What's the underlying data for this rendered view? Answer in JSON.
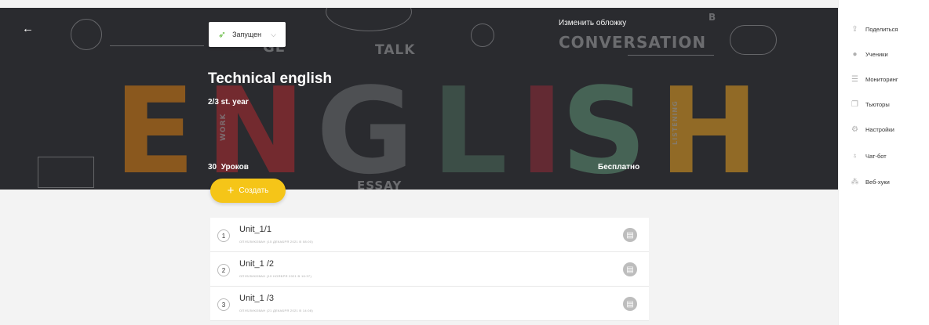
{
  "header": {
    "back_icon": "arrow-left-icon",
    "status": {
      "label": "Запущен",
      "icon": "rocket-icon"
    },
    "change_cover_label": "Изменить обложку",
    "banner_words": [
      "GE",
      "TALK",
      "CONVERSATION",
      "B",
      "ESSAY"
    ],
    "banner_letters": [
      "E",
      "N",
      "G",
      "L",
      "I",
      "S",
      "H"
    ],
    "side_words": [
      "WORK",
      "LISTENING"
    ]
  },
  "course": {
    "title": "Technical english",
    "subtitle": "2/3 st. year",
    "lessons_count": "30",
    "lessons_label": "Уроков",
    "price": "Бесплатно"
  },
  "create_button": {
    "label": "Создать"
  },
  "lessons": [
    {
      "number": "1",
      "name": "Unit_1/1",
      "meta": "ОПУБЛИКОВАН (15 ДЕКАБРЯ 2021 В 08:00)"
    },
    {
      "number": "2",
      "name": "Unit_1 /2",
      "meta": "ОПУБЛИКОВАН (19 НОЯБРЯ 2021 В 16:37)"
    },
    {
      "number": "3",
      "name": "Unit_1 /3",
      "meta": "ОПУБЛИКОВАН (21 ДЕКАБРЯ 2021 В 14:08)"
    }
  ],
  "sidebar": {
    "items": [
      {
        "label": "Поделиться",
        "icon": "share-icon"
      },
      {
        "label": "Ученики",
        "icon": "user-icon"
      },
      {
        "label": "Мониторинг",
        "icon": "monitoring-icon"
      },
      {
        "label": "Тьюторы",
        "icon": "tutors-icon"
      },
      {
        "label": "Настройки",
        "icon": "gear-icon"
      },
      {
        "label": "Чат-бот",
        "icon": "chatbot-icon"
      },
      {
        "label": "Веб-хуки",
        "icon": "webhooks-icon"
      }
    ]
  },
  "colors": {
    "accent": "#f5c518",
    "banner_bg": "#34353a",
    "letter_E": "#c77a1f",
    "letter_N": "#a3343a",
    "letter_G": "#6b6d70",
    "letter_L": "#4f6b5e",
    "letter_I": "#8a3440",
    "letter_S": "#5f8a74",
    "letter_H": "#d1962b"
  }
}
